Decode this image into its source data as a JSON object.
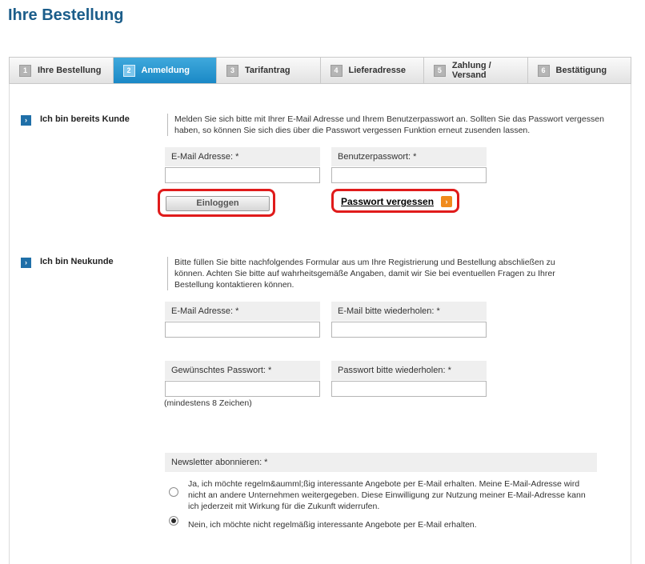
{
  "page_title": "Ihre Bestellung",
  "tabs": [
    {
      "num": "1",
      "label": "Ihre Bestellung",
      "active": false
    },
    {
      "num": "2",
      "label": "Anmeldung",
      "active": true
    },
    {
      "num": "3",
      "label": "Tarifantrag",
      "active": false
    },
    {
      "num": "4",
      "label": "Lieferadresse",
      "active": false
    },
    {
      "num": "5",
      "label": "Zahlung / Versand",
      "active": false
    },
    {
      "num": "6",
      "label": "Bestätigung",
      "active": false
    }
  ],
  "existing": {
    "title": "Ich bin bereits Kunde",
    "description": "Melden Sie sich bitte mit Ihrer E-Mail Adresse und Ihrem Benutzerpasswort an. Sollten Sie das Passwort vergessen haben, so können Sie sich dies über die Passwort vergessen Funktion erneut zusenden lassen.",
    "email_label": "E-Mail Adresse: *",
    "email_value": "",
    "password_label": "Benutzerpasswort: *",
    "password_value": "",
    "login_button": "Einloggen",
    "forgot_link": "Passwort vergessen"
  },
  "new_customer": {
    "title": "Ich bin Neukunde",
    "description": "Bitte füllen Sie bitte nachfolgendes Formular aus um Ihre Registrierung und Bestellung abschließen zu können. Achten Sie bitte auf wahrheitsgemäße Angaben, damit wir Sie bei eventuellen Fragen zu Ihrer Bestellung kontaktieren können.",
    "email_label": "E-Mail Adresse: *",
    "email_repeat_label": "E-Mail bitte wiederholen: *",
    "password_label": "Gewünschtes Passwort: *",
    "password_repeat_label": "Passwort bitte wiederholen: *",
    "password_hint": "(mindestens 8 Zeichen)",
    "email_value": "",
    "email_repeat_value": "",
    "password_value": "",
    "password_repeat_value": ""
  },
  "newsletter": {
    "label": "Newsletter abonnieren: *",
    "option_yes": "Ja, ich möchte regelm&aumml;ßig interessante Angebote per E-Mail erhalten. Meine E-Mail-Adresse wird nicht an andere Unternehmen weitergegeben. Diese Einwilligung zur Nutzung meiner E-Mail-Adresse kann ich jederzeit mit Wirkung für die Zukunft widerrufen.",
    "option_no": "Nein, ich möchte nicht regelmäßig interessante Angebote per E-Mail erhalten.",
    "selected": "no"
  },
  "colors": {
    "title_blue": "#1b5d8a",
    "active_tab": "#1a88c6",
    "highlight_red": "#e01b1b",
    "arrow_orange": "#f08a1c"
  }
}
